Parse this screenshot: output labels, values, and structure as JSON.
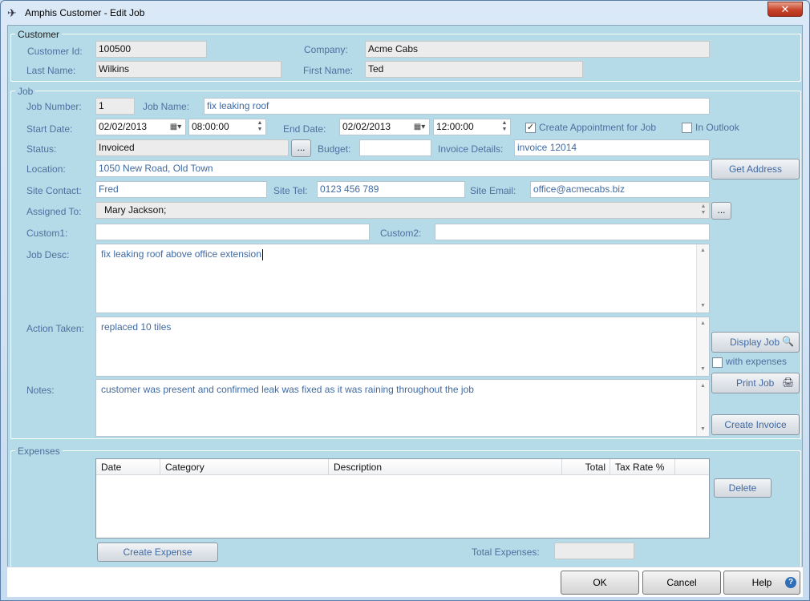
{
  "window": {
    "title": "Amphis Customer - Edit Job",
    "close_label": "✕"
  },
  "customer": {
    "group_title": "Customer",
    "customer_id_label": "Customer Id:",
    "customer_id": "100500",
    "company_label": "Company:",
    "company": "Acme Cabs",
    "last_name_label": "Last Name:",
    "last_name": "Wilkins",
    "first_name_label": "First Name:",
    "first_name": "Ted"
  },
  "job": {
    "group_title": "Job",
    "job_number_label": "Job Number:",
    "job_number": "1",
    "job_name_label": "Job Name:",
    "job_name": "fix leaking roof",
    "start_date_label": "Start Date:",
    "start_date": "02/02/2013",
    "start_time": "08:00:00",
    "end_date_label": "End Date:",
    "end_date": "02/02/2013",
    "end_time": "12:00:00",
    "create_appointment_label": "Create Appointment for Job",
    "create_appointment_checked": true,
    "in_outlook_label": "In Outlook",
    "in_outlook_checked": false,
    "status_label": "Status:",
    "status": "Invoiced",
    "status_picker": "...",
    "budget_label": "Budget:",
    "budget": "",
    "invoice_details_label": "Invoice Details:",
    "invoice_details": "invoice 12014",
    "location_label": "Location:",
    "location": "1050 New Road, Old Town",
    "get_address_label": "Get Address",
    "site_contact_label": "Site Contact:",
    "site_contact": "Fred",
    "site_tel_label": "Site Tel:",
    "site_tel": "0123 456 789",
    "site_email_label": "Site Email:",
    "site_email": "office@acmecabs.biz",
    "assigned_to_label": "Assigned To:",
    "assigned_to": "Mary Jackson;",
    "assigned_picker": "...",
    "custom1_label": "Custom1:",
    "custom1": "",
    "custom2_label": "Custom2:",
    "custom2": "",
    "job_desc_label": "Job Desc:",
    "job_desc": "fix leaking roof above office extension",
    "action_taken_label": "Action Taken:",
    "action_taken": "replaced 10 tiles",
    "notes_label": "Notes:",
    "notes": "customer was present and confirmed leak was fixed as it was raining throughout the job",
    "display_job_label": "Display Job",
    "with_expenses_label": "with expenses",
    "with_expenses_checked": false,
    "print_job_label": "Print Job",
    "create_invoice_label": "Create Invoice"
  },
  "expenses": {
    "group_title": "Expenses",
    "columns": [
      "Date",
      "Category",
      "Description",
      "Total",
      "Tax Rate %"
    ],
    "rows": [],
    "delete_label": "Delete",
    "create_expense_label": "Create Expense",
    "total_expenses_label": "Total Expenses:",
    "total_expenses": ""
  },
  "footer": {
    "ok_label": "OK",
    "cancel_label": "Cancel",
    "help_label": "Help",
    "help_icon": "?"
  }
}
